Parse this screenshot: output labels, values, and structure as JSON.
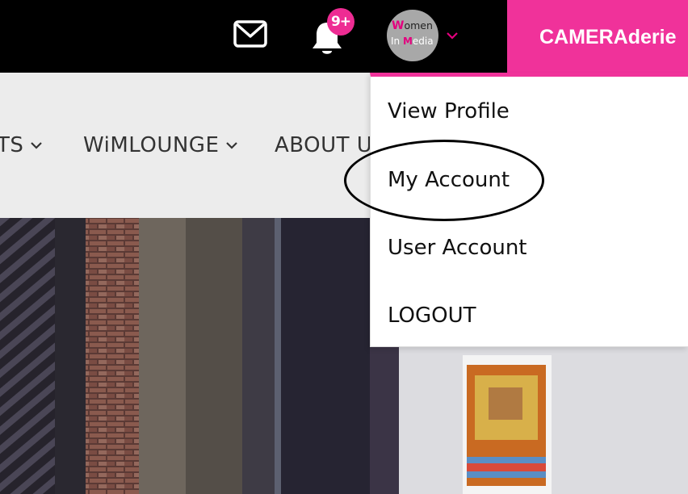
{
  "header": {
    "notifications_badge": "9+",
    "avatar_logo": {
      "line1_first": "W",
      "line1_rest": "omen",
      "line2_first": "In ",
      "line2_m": "M",
      "line2_rest": "edia"
    },
    "brand_label": "CAMERAderie",
    "icons": {
      "mail": "mail-icon",
      "bell": "bell-icon",
      "chevron": "chevron-down-icon"
    },
    "colors": {
      "accent": "#f0329a",
      "badge": "#ee2c93",
      "topbar": "#000000"
    }
  },
  "nav": {
    "items": [
      {
        "label": "TS"
      },
      {
        "label": "WiMLOUNGE"
      },
      {
        "label": "ABOUT U"
      }
    ],
    "background": "#ececec"
  },
  "user_menu": {
    "items": [
      {
        "label": "View Profile"
      },
      {
        "label": "My Account"
      },
      {
        "label": "User Account"
      },
      {
        "label": "LOGOUT"
      }
    ]
  }
}
